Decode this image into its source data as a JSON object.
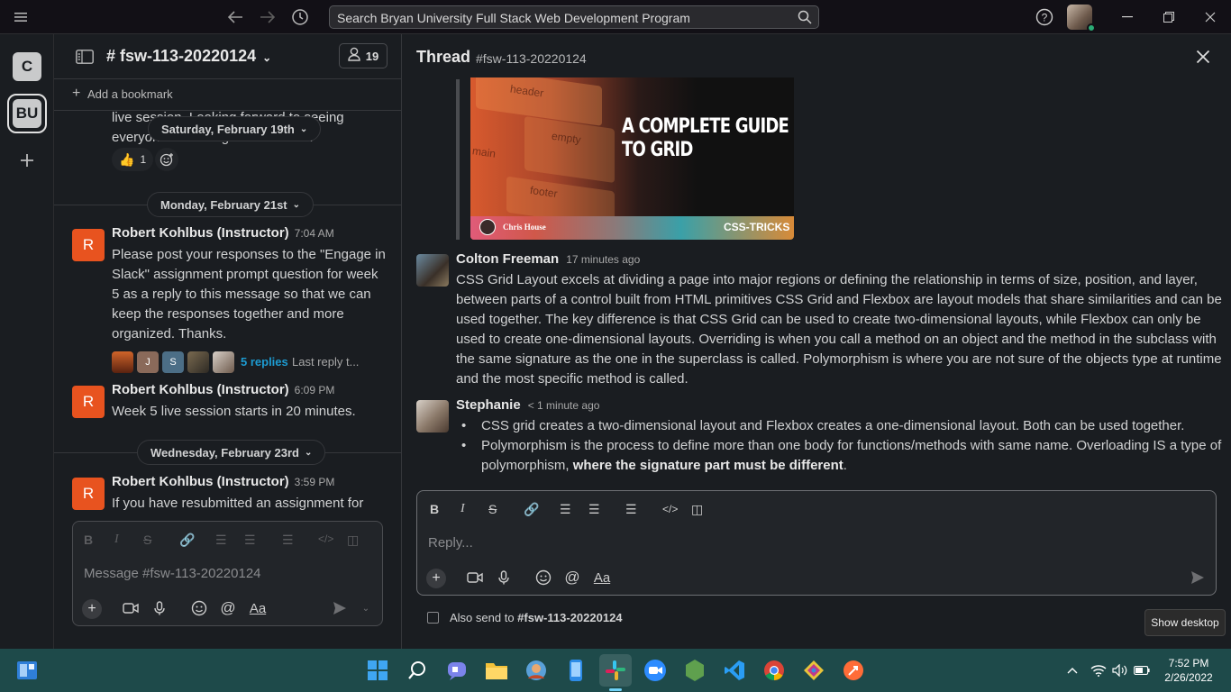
{
  "topbar": {
    "search_text": "Search Bryan University Full Stack Web Development Program"
  },
  "workspaces": [
    {
      "label": "C"
    },
    {
      "label": "BU"
    }
  ],
  "channel": {
    "name": "# fsw-113-20220124",
    "member_count": "19",
    "add_bookmark": "Add a bookmark",
    "partial_text_1": "live session. Looking forward to seeing",
    "partial_text_2": "everyone! Have a good weekend.",
    "date_sat": "Saturday, February 19th",
    "reaction_emoji": "👍",
    "reaction_count": "1",
    "date_mon": "Monday, February 21st",
    "date_wed": "Wednesday, February 23rd",
    "messages": [
      {
        "avatar": "R",
        "author": "Robert Kohlbus (Instructor)",
        "time": "7:04 AM",
        "text": "Please post your responses to the \"Engage in Slack\" assignment prompt question for week 5 as a reply to this message so that we can keep the responses together and more organized. Thanks.",
        "replies": "5 replies",
        "last_reply": "Last reply t..."
      },
      {
        "avatar": "R",
        "author": "Robert Kohlbus (Instructor)",
        "time": "6:09 PM",
        "text": "Week 5 live session starts in 20 minutes."
      },
      {
        "avatar": "R",
        "author": "Robert Kohlbus (Instructor)",
        "time": "3:59 PM",
        "text": "If you have resubmitted an assignment for"
      }
    ],
    "reply_avatars": [
      "",
      "J",
      "S",
      "",
      ""
    ],
    "composer_placeholder": "Message #fsw-113-20220124"
  },
  "thread": {
    "title": "Thread",
    "channel": "#fsw-113-20220124",
    "image": {
      "headline_1": "A COMPLETE GUIDE",
      "headline_2": "TO GRID",
      "author": "Chris House",
      "brand": "CSS-TRICKS",
      "tag_header": "header",
      "tag_main": "main",
      "tag_empty": "empty",
      "tag_footer": "footer"
    },
    "messages": [
      {
        "author": "Colton Freeman",
        "time": "17 minutes ago",
        "text": "CSS Grid Layout excels at dividing a page into major regions or defining the relationship in terms of size, position, and layer, between parts of a control built from HTML primitives CSS Grid and Flexbox are layout models that share similarities and can be used together. The key difference is that CSS Grid can be used to create two-dimensional layouts, while Flexbox can only be used to create one-dimensional layouts. Overriding is when you call a method on an object and the method in the subclass with the same signature as the one in the superclass is called. Polymorphism is where you are not sure of the objects type at runtime and the most specific method is called."
      },
      {
        "author": "Stephanie",
        "time": "< 1 minute ago",
        "bullet_1": "CSS grid creates a two-dimensional layout and Flexbox creates a one-dimensional layout. Both can be used together.",
        "bullet_2_plain": "Polymorphism is the process to define more than one body for functions/methods with same name. Overloading IS a type of polymorphism, ",
        "bullet_2_bold": "where the signature part must be different",
        "bullet_2_end": "."
      }
    ],
    "reply_placeholder": "Reply...",
    "also_send_label": "Also send to ",
    "also_send_channel": "#fsw-113-20220124"
  },
  "tooltip": "Show desktop",
  "taskbar": {
    "time": "7:52 PM",
    "date": "2/26/2022"
  },
  "colors": {
    "avatar_orange": "#e8531f",
    "link_blue": "#1d9bd1",
    "taskbar_bg": "#1e4a4a"
  }
}
